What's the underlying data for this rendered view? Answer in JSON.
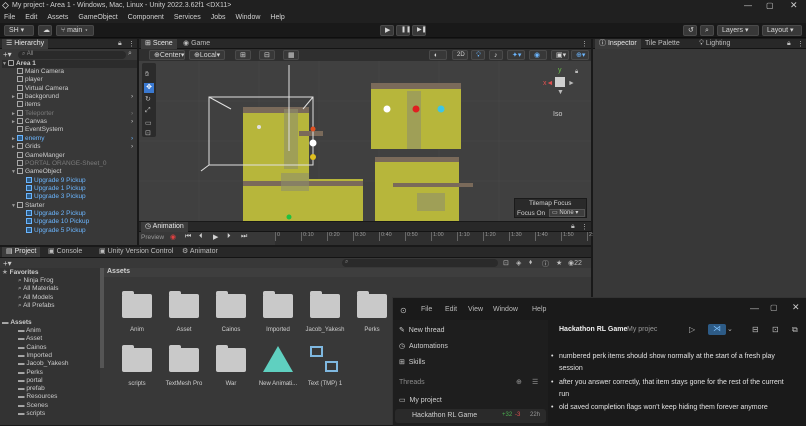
{
  "window": {
    "title": "My project - Area 1 - Windows, Mac, Linux - Unity 2022.3.62f1 <DX11>"
  },
  "menu": [
    "File",
    "Edit",
    "Assets",
    "GameObject",
    "Component",
    "Services",
    "Jobs",
    "Window",
    "Help"
  ],
  "toolbar": {
    "account": "SH",
    "branch": "main",
    "layers": "Layers",
    "layout": "Layout"
  },
  "hierarchy": {
    "tab": "Hierarchy",
    "search": "All",
    "scene": "Area 1",
    "items": [
      {
        "label": "Main Camera",
        "indent": 1,
        "style": "normal",
        "arrow": false
      },
      {
        "label": "player",
        "indent": 1,
        "style": "normal",
        "arrow": false
      },
      {
        "label": "Virtual Camera",
        "indent": 1,
        "style": "normal",
        "arrow": false
      },
      {
        "label": "backgorund",
        "indent": 1,
        "style": "normal",
        "arrow": true
      },
      {
        "label": "items",
        "indent": 1,
        "style": "normal",
        "arrow": false
      },
      {
        "label": "Teleporter",
        "indent": 1,
        "style": "gray",
        "arrow": true
      },
      {
        "label": "Canvas",
        "indent": 1,
        "style": "normal",
        "arrow": true
      },
      {
        "label": "EventSystem",
        "indent": 1,
        "style": "normal",
        "arrow": false
      },
      {
        "label": "enemy",
        "indent": 1,
        "style": "blue",
        "arrow": true
      },
      {
        "label": "Grids",
        "indent": 1,
        "style": "normal",
        "arrow": true
      },
      {
        "label": "GameManger",
        "indent": 1,
        "style": "normal",
        "arrow": false
      },
      {
        "label": "PORTAL ORANGE-Sheet_0",
        "indent": 1,
        "style": "gray",
        "arrow": false
      },
      {
        "label": "GameObject",
        "indent": 1,
        "style": "normal",
        "arrow": true,
        "open": true
      },
      {
        "label": "Upgrade 9 Pickup",
        "indent": 2,
        "style": "blue",
        "arrow": false
      },
      {
        "label": "Upgrade 1 Pickup",
        "indent": 2,
        "style": "blue",
        "arrow": false
      },
      {
        "label": "Upgrade 3 Pickup",
        "indent": 2,
        "style": "blue",
        "arrow": false
      },
      {
        "label": "Starter",
        "indent": 1,
        "style": "normal",
        "arrow": true,
        "open": true
      },
      {
        "label": "Upgrade 2 Pickup",
        "indent": 2,
        "style": "blue",
        "arrow": false
      },
      {
        "label": "Upgrade 10 Pickup",
        "indent": 2,
        "style": "blue",
        "arrow": false
      },
      {
        "label": "Upgrade 5 Pickup",
        "indent": 2,
        "style": "blue",
        "arrow": false
      }
    ]
  },
  "scene": {
    "tabs": [
      "Scene",
      "Game"
    ],
    "pivot": "Center",
    "space": "Local",
    "mode2d": "2D",
    "view_label": "Iso",
    "tilemap_focus": {
      "title": "Tilemap Focus",
      "label": "Focus On",
      "value": "None"
    }
  },
  "inspector": {
    "tabs": [
      "Inspector",
      "Tile Palette",
      "Lighting"
    ]
  },
  "animation": {
    "tab": "Animation",
    "preview": "Preview",
    "ticks": [
      "0",
      "0:10",
      "0:20",
      "0:30",
      "0:40",
      "0:50",
      "1:00",
      "1:10",
      "1:20",
      "1:30",
      "1:40",
      "1:50",
      "2:00"
    ]
  },
  "project": {
    "tabs": [
      "Project",
      "Console",
      "Unity Version Control",
      "Animator"
    ],
    "badge": "22",
    "assets_header": "Assets",
    "favorites": {
      "label": "Favorites",
      "items": [
        "Ninja Frog",
        "All Materials",
        "All Models",
        "All Prefabs"
      ]
    },
    "tree": {
      "label": "Assets",
      "items": [
        "Anim",
        "Asset",
        "Cainos",
        "Imported",
        "Jacob_Yakesh",
        "Perks",
        "portal",
        "prefab",
        "Resources",
        "Scenes",
        "scripts"
      ]
    },
    "grid": [
      "Anim",
      "Asset",
      "Cainos",
      "Imported",
      "Jacob_Yakesh",
      "Perks",
      "scripts",
      "TextMesh Pro",
      "War",
      "New Animati...",
      "Text (TMP) 1"
    ]
  },
  "codex": {
    "menu": [
      "File",
      "Edit",
      "View",
      "Window",
      "Help"
    ],
    "nav": [
      "New thread",
      "Automations",
      "Skills"
    ],
    "threads_label": "Threads",
    "project": "My project",
    "thread": {
      "name": "Hackathon RL Game",
      "added": "+32",
      "removed": "-3",
      "age": "22h"
    },
    "header": {
      "title": "Hackathon RL Game",
      "project": "My projec"
    },
    "bullets": [
      "numbered perk items should show normally at the start of a fresh play session",
      "after you answer correctly, that item stays gone for the rest of the current run",
      "old saved completion flags won't keep hiding them forever anymore"
    ]
  },
  "colors": {
    "blue": "#6bb6ff",
    "accent": "#3a79d1",
    "panel": "#383838",
    "grass": "#b7b63b"
  }
}
